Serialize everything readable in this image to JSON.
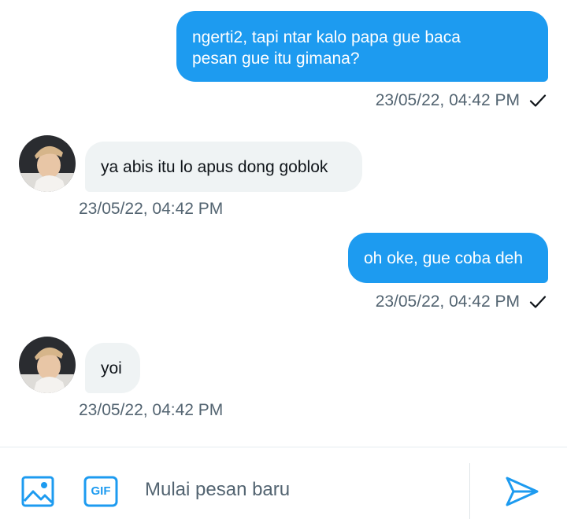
{
  "messages": [
    {
      "id": 1,
      "direction": "out",
      "lines": [
        "ngerti2, tapi ntar kalo papa gue baca",
        "pesan gue itu gimana?"
      ],
      "timestamp": "23/05/22, 04:42 PM",
      "read_receipt": "check-icon"
    },
    {
      "id": 2,
      "direction": "in",
      "text": "ya abis itu lo apus dong goblok",
      "timestamp": "23/05/22, 04:42 PM"
    },
    {
      "id": 3,
      "direction": "out",
      "text": "oh oke, gue coba deh",
      "timestamp": "23/05/22, 04:42 PM",
      "read_receipt": "check-icon"
    },
    {
      "id": 4,
      "direction": "in",
      "text": "yoi",
      "timestamp": "23/05/22, 04:42 PM"
    }
  ],
  "composer": {
    "placeholder": "Mulai pesan baru",
    "media_icon": "image-icon",
    "gif_label": "GIF",
    "send_icon": "send-icon"
  },
  "colors": {
    "accent": "#1d9bf0",
    "incoming_bubble": "#eff3f4",
    "meta_text": "#536471"
  }
}
